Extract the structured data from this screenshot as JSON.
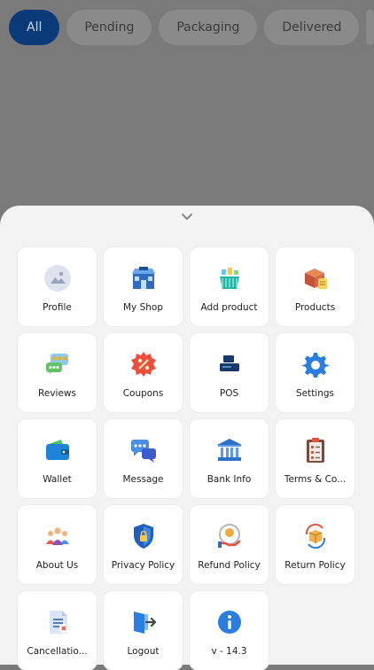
{
  "tabs": [
    {
      "label": "All",
      "active": true
    },
    {
      "label": "Pending",
      "active": false
    },
    {
      "label": "Packaging",
      "active": false
    },
    {
      "label": "Delivered",
      "active": false
    }
  ],
  "menu": [
    {
      "label": "Profile",
      "icon": "profile-image-icon"
    },
    {
      "label": "My Shop",
      "icon": "shop-icon"
    },
    {
      "label": "Add product",
      "icon": "add-product-icon"
    },
    {
      "label": "Products",
      "icon": "products-box-icon"
    },
    {
      "label": "Reviews",
      "icon": "reviews-icon"
    },
    {
      "label": "Coupons",
      "icon": "coupon-icon"
    },
    {
      "label": "POS",
      "icon": "pos-icon"
    },
    {
      "label": "Settings",
      "icon": "gear-icon"
    },
    {
      "label": "Wallet",
      "icon": "wallet-icon"
    },
    {
      "label": "Message",
      "icon": "message-icon"
    },
    {
      "label": "Bank Info",
      "icon": "bank-icon"
    },
    {
      "label": "Terms & Co...",
      "icon": "terms-clipboard-icon"
    },
    {
      "label": "About Us",
      "icon": "about-us-people-icon"
    },
    {
      "label": "Privacy Policy",
      "icon": "shield-icon"
    },
    {
      "label": "Refund Policy",
      "icon": "refund-icon"
    },
    {
      "label": "Return Policy",
      "icon": "return-box-icon"
    },
    {
      "label": "Cancellatio...",
      "icon": "cancellation-document-icon"
    },
    {
      "label": "Logout",
      "icon": "logout-icon"
    },
    {
      "label": "v - 14.3",
      "icon": "info-icon"
    }
  ]
}
